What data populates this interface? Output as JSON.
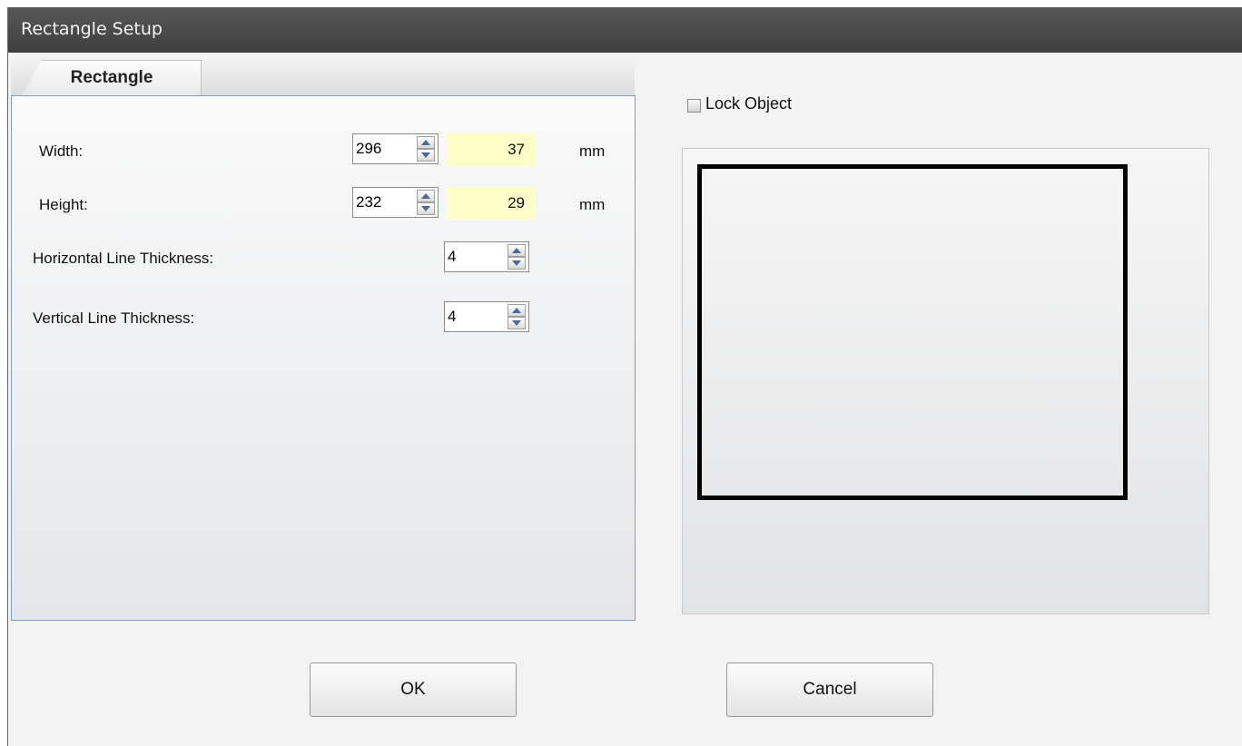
{
  "window": {
    "title": "Rectangle Setup"
  },
  "tabs": [
    {
      "label": "Rectangle"
    }
  ],
  "fields": {
    "width": {
      "label": "Width:",
      "value": "296",
      "mm": "37",
      "unit": "mm"
    },
    "height": {
      "label": "Height:",
      "value": "232",
      "mm": "29",
      "unit": "mm"
    },
    "h_thickness": {
      "label": "Horizontal Line Thickness:",
      "value": "4"
    },
    "v_thickness": {
      "label": "Vertical Line Thickness:",
      "value": "4"
    }
  },
  "lock": {
    "label": "Lock Object",
    "checked": false
  },
  "buttons": {
    "ok": "OK",
    "cancel": "Cancel"
  },
  "icons": {
    "spin": "spin-up-down-icon",
    "checkbox": "checkbox-unchecked-icon"
  }
}
